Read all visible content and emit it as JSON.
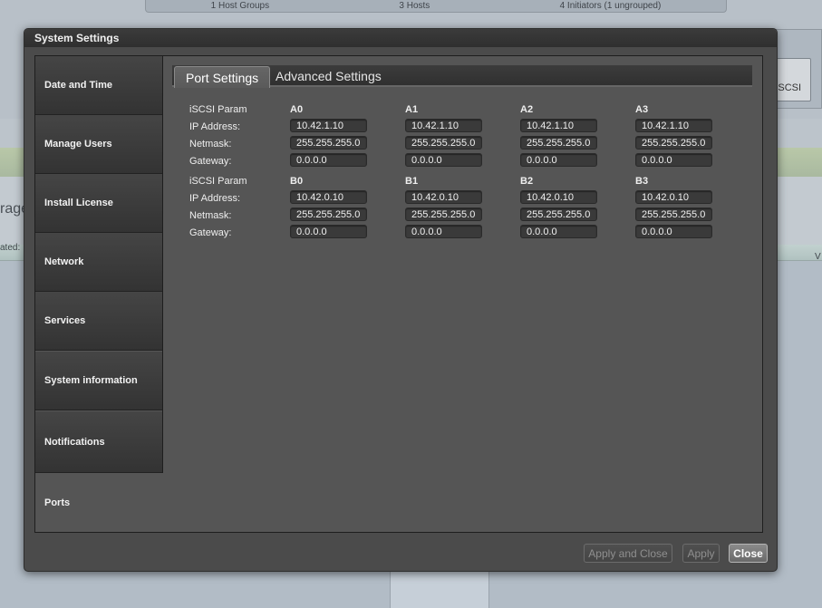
{
  "background": {
    "summary": [
      "1 Host Groups",
      "3 Hosts",
      "4 Initiators (1 ungrouped)"
    ],
    "partial_text_left": "rage",
    "partial_small_left": "ated:",
    "partial_right": "V",
    "iscsi_button": "iSCSI"
  },
  "dialog": {
    "title": "System Settings"
  },
  "sidebar": {
    "items": [
      {
        "label": "Date and Time"
      },
      {
        "label": "Manage Users"
      },
      {
        "label": "Install License"
      },
      {
        "label": "Network"
      },
      {
        "label": "Services"
      },
      {
        "label": "System information"
      },
      {
        "label": "Notifications"
      },
      {
        "label": "Ports",
        "active": true
      }
    ]
  },
  "tabs": [
    {
      "label": "Port Settings",
      "active": true
    },
    {
      "label": "Advanced Settings",
      "active": false
    }
  ],
  "row_labels": {
    "param": "iSCSI Param",
    "ip": "IP Address:",
    "netmask": "Netmask:",
    "gateway": "Gateway:"
  },
  "port_groups": [
    {
      "ports": [
        {
          "name": "A0",
          "ip": "10.42.1.10",
          "netmask": "255.255.255.0",
          "gateway": "0.0.0.0"
        },
        {
          "name": "A1",
          "ip": "10.42.1.10",
          "netmask": "255.255.255.0",
          "gateway": "0.0.0.0"
        },
        {
          "name": "A2",
          "ip": "10.42.1.10",
          "netmask": "255.255.255.0",
          "gateway": "0.0.0.0"
        },
        {
          "name": "A3",
          "ip": "10.42.1.10",
          "netmask": "255.255.255.0",
          "gateway": "0.0.0.0"
        }
      ]
    },
    {
      "ports": [
        {
          "name": "B0",
          "ip": "10.42.0.10",
          "netmask": "255.255.255.0",
          "gateway": "0.0.0.0"
        },
        {
          "name": "B1",
          "ip": "10.42.0.10",
          "netmask": "255.255.255.0",
          "gateway": "0.0.0.0"
        },
        {
          "name": "B2",
          "ip": "10.42.0.10",
          "netmask": "255.255.255.0",
          "gateway": "0.0.0.0"
        },
        {
          "name": "B3",
          "ip": "10.42.0.10",
          "netmask": "255.255.255.0",
          "gateway": "0.0.0.0"
        }
      ]
    }
  ],
  "footer": {
    "apply_and_close": "Apply and Close",
    "apply": "Apply",
    "close": "Close"
  }
}
